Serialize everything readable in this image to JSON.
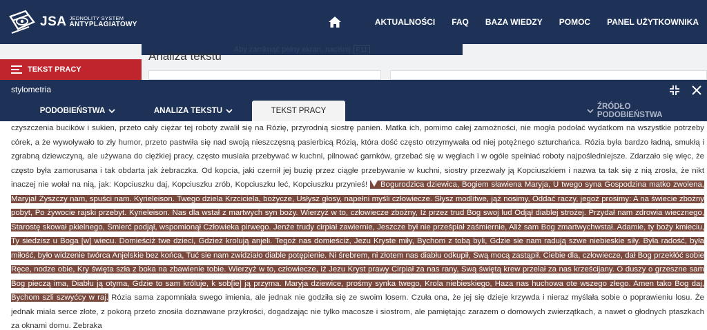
{
  "header": {
    "logo": {
      "main": "JSA",
      "line1": "JEDNOLITY SYSTEM",
      "line2": "ANTYPLAGIATOWY"
    },
    "nav": [
      "AKTUALNOŚCI",
      "FAQ",
      "BAZA WIEDZY",
      "POMOC",
      "PANEL UŻYTKOWNIKA"
    ]
  },
  "background": {
    "notice": "Aby zamknąć pełny ekran, naciśnij",
    "notice_key": "F11",
    "page_title": "Analiza tekstu",
    "side_active": "TEKST PRACY"
  },
  "modal": {
    "title": "stylometria",
    "tabs": [
      {
        "label": "PODOBIEŃSTWA",
        "chevron": true
      },
      {
        "label": "ANALIZA TEKSTU",
        "chevron": true
      },
      {
        "label": "TEKST PRACY",
        "active": true
      }
    ],
    "right_tab": "ŹRÓDŁO PODOBIEŃSTWA"
  },
  "document": {
    "before": "czyszczenia bucików i sukien, przeto cały ciężar tej roboty zwalił się na Rózię, przyrodnią siostrę panien. Matka ich, pomimo całej zamożności, nie mogła podołać wydatkom na wszystkie potrzeby córek, a że wywoływało to zły humor, przeto pastwiła się nad swoją nieszczęsną pasierbicą Rózią, która dość często otrzymywała od niej potężnego szturchańca. Rózia była bardzo ładną, smukłą i zgrabną dziewczyną, ale używana do ciężkiej pracy, często musiała przebywać w kuchni, pilnować garnków, grzebać się w węglach i w ogóle spełniać roboty najpośledniejsze. Zdarzało się więc, że często była zamorusana i tak obdarta jak żebraczka. Od kopcia, jaki czernił jej buzię przez ciągłe przebywanie w kuchni, siostry przezwały ją Kopciuszkiem i nazwa ta tak się z nią zrosła, że nikt inaczej nie wołał na nią, jak: Kopciuszku daj, Kopciuszku zrób, Kopciuszku leć, Kopciuszku przynieś!",
    "highlight": "Bogurodzica dziewica, Bogiem sławiena Maryja, U twego syna Gospodzina matko zwolena, Maryja! Zyszczy nam, spuści nam. Kyrieleison. Twego dziela Krzciciela, bożycze, Usłysz głosy, napełni myśli człowiecze. Słysz modlitwe, jąż nosimy, Oddać raczy, jegoż prosimy: A na świecie zbożny pobyt, Po żywocie rajski przebyt. Kyrieleison. Nas dla wstał z martwych syn boży. Wierzyż w to, człowiecze zbożny, Iż przez trud Bog swoj lud Odjął diablej strożej. Przydał nam zdrowia wiecznego, Starostę skował pkielnego, Śmierć podjął, wspomionął Człowieka pirwego. Jenże trudy cirpiał zawiernie, Jeszcze był nie prześpiał zaśmiernie, Aliż sam Bog zmartwychwstał. Adamie, ty boży kmieciu, Ty siedzisz u Boga [w] wiecu. Domieściż twe dzieci, Gdzież krolują anjeli. Tegoż nas domieściż, Jezu Kryste miły, Bychom z tobą byli, Gdzie sie nam radują szwe niebieskie siły. Była radość, była miłość, było widzenie twórca Anjelskie bez końca, Tuć sie nam zwidziało diable potępienie. Ni śrebrem, ni złotem nas diabłu odkupił, Swą mocą zastąpił. Ciebie dla, człowiecze, dał Bog przekłóć sobie Ręce, nodze obie, Kry święta szła z boka na zbawienie tobie. Wierzyż w to, człowiecze, iż Jezu Kryst prawy Cirpiał za nas rany, Swą świętą krew przelał za nas krześcijany. O duszy o grzeszne sam Bog pieczą ima, Diabłu ją otyma, Gdzie to sam króluje, k sob[ie] ją przyma. Maryja dziewice, prośmy synka twego, Krola niebieskiego, Haza nas huchowa ote wszego złego. Amen tako Bog daj, Bychom szli szwyćcy w raj.",
    "after": "Rózia sama zapomniała swego imienia, ale jednak nie godziła się ze swoim losem. Czuła ona, że jej się dzieje krzywda i nieraz myślała sobie o poprawieniu losu. Że jednak miała serce złote, z pokorą przeto znosiła doznawane przykrości, dogadzając nie tylko macosze i siostrom, ale pamiętając zarazem o domowych zwierzątkach, a nawet o głodnych ptaszkach za oknami domu. Zebraka"
  },
  "colors": {
    "nav_bg": "#1e3258",
    "accent_red": "#c0252d",
    "highlight_bg": "#7a4a3f"
  },
  "icons": {
    "home": "home-icon",
    "collapse": "collapse-icon",
    "close": "close-icon",
    "chevron": "chevron-down-icon",
    "marker": "marker-icon",
    "menu": "menu-lines-icon"
  }
}
